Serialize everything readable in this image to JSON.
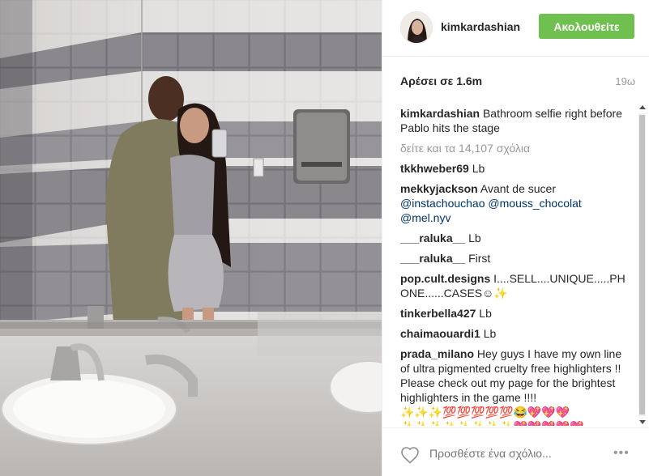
{
  "header": {
    "username": "kimkardashian",
    "follow_label": "Ακολουθείτε"
  },
  "stats": {
    "likes_prefix": "Αρέσει σε",
    "likes_count": "1.6m",
    "time_ago": "19ω"
  },
  "caption": {
    "user": "kimkardashian",
    "text": "Bathroom selfie right before Pablo hits the stage"
  },
  "view_all_comments": "δείτε και τα 14,107 σχόλια",
  "comments": [
    {
      "user": "tkkhweber69",
      "text": "Lb"
    },
    {
      "user": "mekkyjackson",
      "text": "Avant de sucer",
      "mentions": [
        "@instachouchao",
        "@mouss_chocolat",
        "@mel.nyv"
      ]
    },
    {
      "user": "___raluka__",
      "text": "Lb"
    },
    {
      "user": "___raluka__",
      "text": "First"
    },
    {
      "user": "pop.cult.designs",
      "text": "I....SELL....UNIQUE.....PHONE......CASES☺✨"
    },
    {
      "user": "tinkerbella427",
      "text": "Lb"
    },
    {
      "user": "chaimaouardi1",
      "text": "Lb"
    },
    {
      "user": "prada_milano",
      "text": "Hey guys I have my own line of ultra pigmented cruelty free highlighters !! Please check out my page for the brightest highlighters in the game !!!! ✨✨✨💯💯💯💯💯😂💖💖💖 ✨✨✨✨✨✨✨✨💖💖💖💖💖"
    }
  ],
  "footer": {
    "comment_placeholder": "Προσθέστε ένα σχόλιο...",
    "more_label": "•••"
  },
  "icons": {
    "like": "heart-icon",
    "more": "more-options-icon",
    "avatar": "profile-avatar"
  },
  "colors": {
    "follow_button": "#70c050",
    "mention": "#003569",
    "muted": "#999999"
  }
}
